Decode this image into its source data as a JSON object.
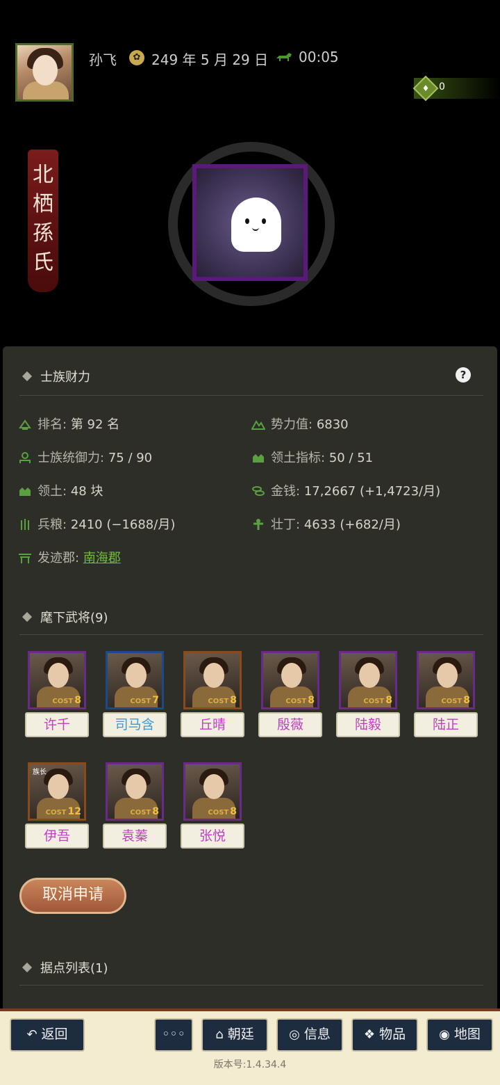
{
  "header": {
    "player_name": "孙飞",
    "date": "249 年 5 月 29 日",
    "time": "00:05",
    "bag_count": "0",
    "clan_name": [
      "北",
      "栖",
      "孫",
      "氏"
    ]
  },
  "clan_wealth": {
    "title": "士族财力",
    "help": "?",
    "stats": [
      {
        "label": "排名:",
        "value": "第 92 名",
        "icon": "rank-icon"
      },
      {
        "label": "势力值:",
        "value": "6830",
        "icon": "mountain-icon"
      },
      {
        "label": "士族统御力:",
        "value": "75 / 90",
        "icon": "leader-icon"
      },
      {
        "label": "领土指标:",
        "value": "50 / 51",
        "icon": "territory-icon"
      },
      {
        "label": "领土:",
        "value": "48 块",
        "icon": "land-icon"
      },
      {
        "label": "金钱:",
        "value": "17,2667 (+1,4723/月)",
        "icon": "coins-icon"
      },
      {
        "label": "兵粮:",
        "value": "2410 (−1688/月)",
        "icon": "grain-icon"
      },
      {
        "label": "壮丁:",
        "value": "4633 (+682/月)",
        "icon": "manpower-icon"
      },
      {
        "label": "发迹郡:",
        "value": "南海郡",
        "icon": "gate-icon"
      }
    ]
  },
  "generals": {
    "title": "麾下武将(9)",
    "list": [
      {
        "name": "许千",
        "cost": "8",
        "border": "#6a2a8a",
        "color": "#c040c0"
      },
      {
        "name": "司马含",
        "cost": "7",
        "border": "#1a4a8a",
        "color": "#3a9ad0"
      },
      {
        "name": "丘晴",
        "cost": "8",
        "border": "#8a4a1a",
        "color": "#c040c0"
      },
      {
        "name": "殷薇",
        "cost": "8",
        "border": "#6a2a8a",
        "color": "#c040c0"
      },
      {
        "name": "陆毅",
        "cost": "8",
        "border": "#6a2a8a",
        "color": "#c040c0"
      },
      {
        "name": "陆正",
        "cost": "8",
        "border": "#6a2a8a",
        "color": "#c040c0"
      },
      {
        "name": "伊吾",
        "cost": "12",
        "border": "#8a4a1a",
        "color": "#c040c0",
        "chief": "族长"
      },
      {
        "name": "袁蓁",
        "cost": "8",
        "border": "#6a2a8a",
        "color": "#c040c0"
      },
      {
        "name": "张悦",
        "cost": "8",
        "border": "#6a2a8a",
        "color": "#c040c0"
      }
    ],
    "cost_label": "COST"
  },
  "cancel_button": "取消申请",
  "strongholds": {
    "title": "据点列表(1)"
  },
  "nav": {
    "back": "返回",
    "more": "◦◦◦",
    "court": "朝廷",
    "info": "信息",
    "items": "物品",
    "map": "地图"
  },
  "version": "版本号:1.4.34.4"
}
